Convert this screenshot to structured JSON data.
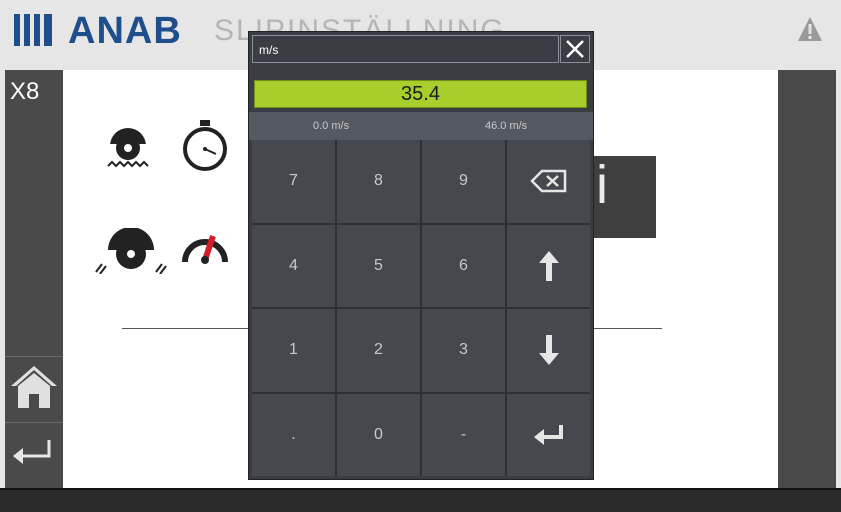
{
  "header": {
    "logo_text": "ANAB",
    "page_title": "SLIPINSTÄLLNING"
  },
  "sidebar": {
    "machine_label": "X8"
  },
  "dialog": {
    "unit_label": "m/s",
    "value": "35.4",
    "min_label": "0.0 m/s",
    "max_label": "46.0 m/s",
    "keys": [
      "7",
      "8",
      "9",
      "backspace",
      "4",
      "5",
      "6",
      "up",
      "1",
      "2",
      "3",
      "down",
      ".",
      "0",
      "-",
      "enter"
    ]
  },
  "colors": {
    "accent_blue": "#1f4e8c",
    "value_green": "#a6cf2d",
    "dialog_bg": "#3a3d44",
    "sidebar_bg": "#4a4a4a"
  },
  "icons": [
    "warning-icon",
    "home-icon",
    "back-icon",
    "close-icon",
    "backspace-icon",
    "arrow-up-icon",
    "arrow-down-icon",
    "enter-icon",
    "saw-blade-icon",
    "stopwatch-icon",
    "speedometer-icon",
    "saw-speed-icon"
  ]
}
